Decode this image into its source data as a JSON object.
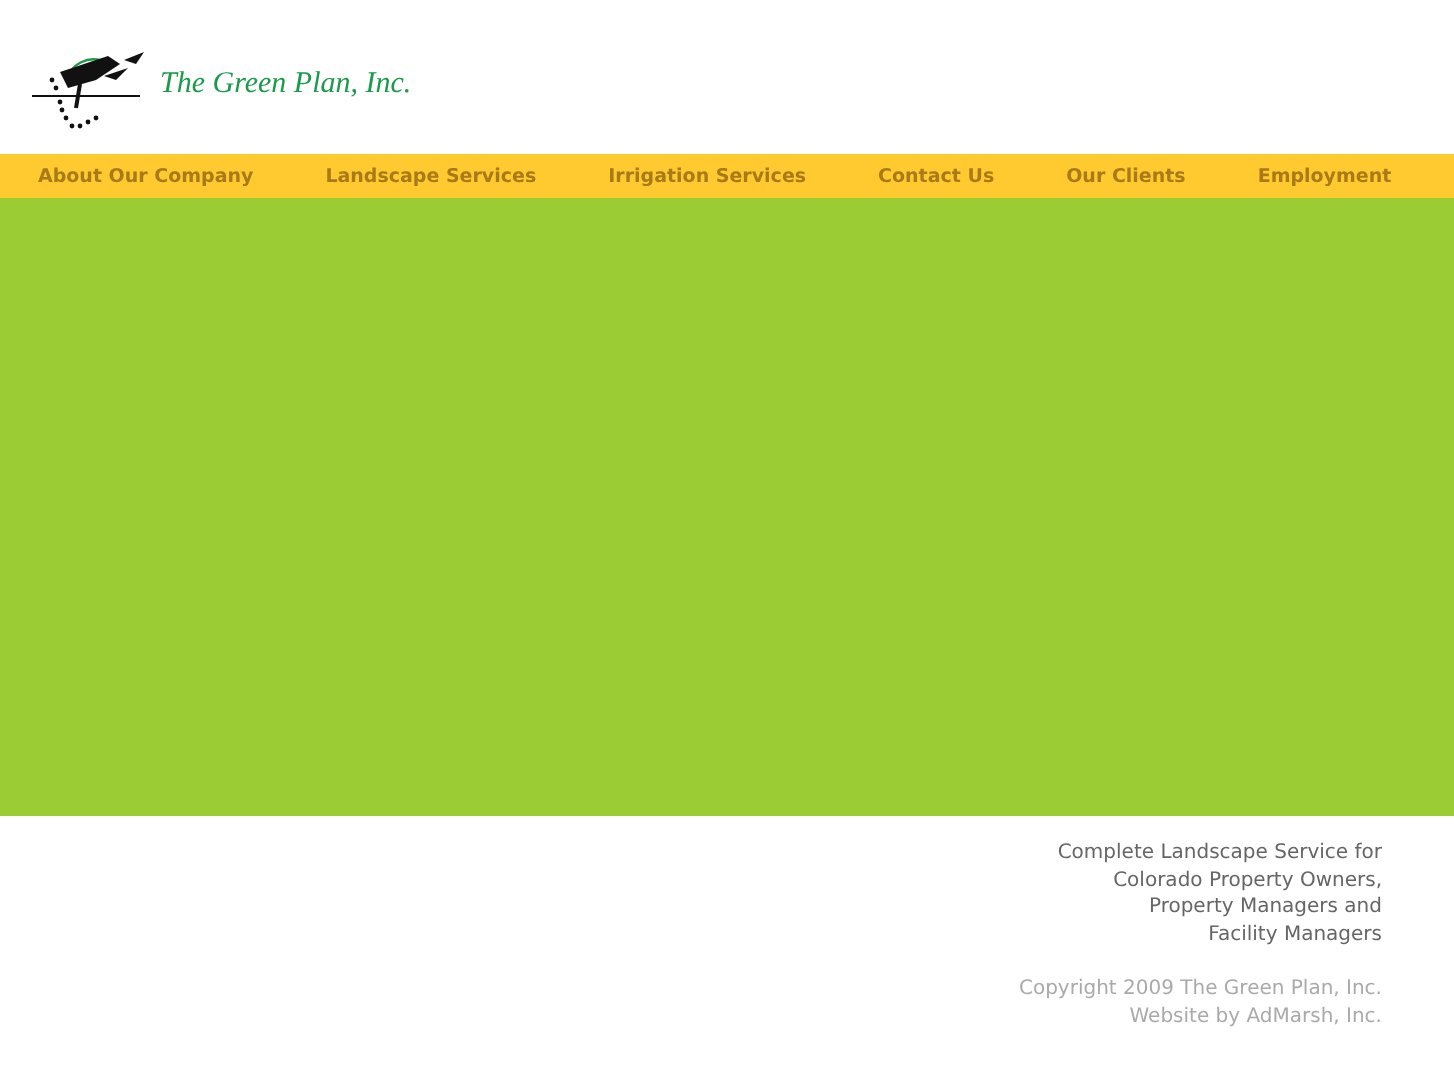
{
  "logo": {
    "text": "The Green Plan, Inc."
  },
  "nav": [
    {
      "label": "About Our Company"
    },
    {
      "label": "Landscape Services"
    },
    {
      "label": "Irrigation Services"
    },
    {
      "label": "Contact Us"
    },
    {
      "label": "Our Clients"
    },
    {
      "label": "Employment"
    }
  ],
  "footer": {
    "tagline": [
      "Complete Landscape Service for",
      "Colorado Property Owners,",
      "Property Managers and",
      "Facility Managers"
    ],
    "credits": [
      "Copyright 2009 The Green Plan, Inc.",
      "Website by AdMarsh, Inc."
    ]
  }
}
